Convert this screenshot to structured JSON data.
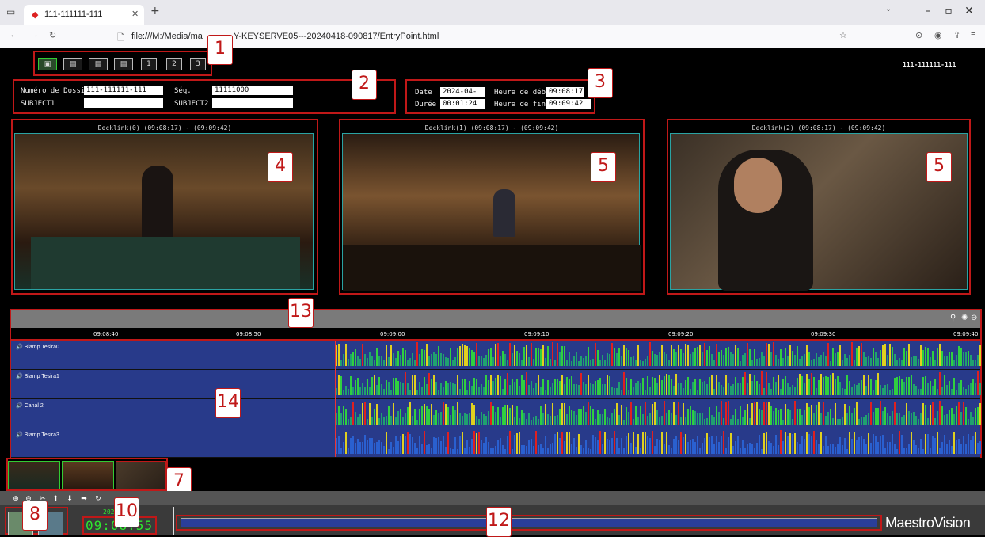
{
  "browser": {
    "tab_title": "111-111111-111",
    "new_tab": "+",
    "url": "file:///M:/Media/ma",
    "url_tail": "Y-KEYSERVE05---20240418-090817/EntryPoint.html"
  },
  "header": {
    "layout_buttons": [
      "1",
      "2",
      "3"
    ],
    "file_id": "111-111111-111"
  },
  "dossier": {
    "numero_label": "Numéro de Dossier",
    "numero_value": "111-111111-111",
    "seq_label": "Séq.",
    "seq_value": "11111000",
    "subject1_label": "SUBJECT1",
    "subject1_value": "",
    "subject2_label": "SUBJECT2",
    "subject2_value": ""
  },
  "timing": {
    "date_label": "Date",
    "date_value": "2024-04-18",
    "debut_label": "Heure de début",
    "debut_value": "09:08:17",
    "duree_label": "Durée",
    "duree_value": "00:01:24",
    "fin_label": "Heure de fin",
    "fin_value": "09:09:42"
  },
  "videos": [
    {
      "title": "Decklink(0) (09:08:17) - (09:09:42)"
    },
    {
      "title": "Decklink(1) (09:08:17) - (09:09:42)"
    },
    {
      "title": "Decklink(2) (09:08:17) - (09:09:42)"
    }
  ],
  "timeline": {
    "ticks": [
      "09:08:40",
      "09:08:50",
      "09:09:00",
      "09:09:10",
      "09:09:20",
      "09:09:30",
      "09:09:40"
    ]
  },
  "tracks": [
    {
      "label": "Biamp Tesira0"
    },
    {
      "label": "Biamp Tesira1"
    },
    {
      "label": "Canal 2"
    },
    {
      "label": "Biamp Tesira3"
    }
  ],
  "player": {
    "date_partial": "202",
    "clock": "09:08:55"
  },
  "brand": "MaestroVision",
  "callouts": [
    "1",
    "2",
    "3",
    "4",
    "5",
    "5",
    "7",
    "8",
    "10",
    "12",
    "13",
    "14"
  ],
  "colors": {
    "accent_red": "#c01818",
    "track_bg": "#283a8a",
    "clock_green": "#2ee82e"
  }
}
